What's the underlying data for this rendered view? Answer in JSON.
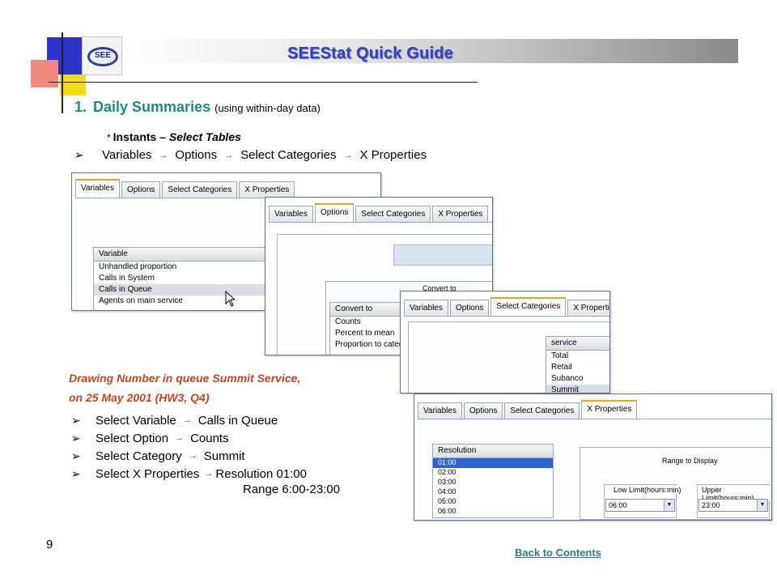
{
  "header": {
    "logo_text": "SEE",
    "title": "SEEStat Quick Guide"
  },
  "section": {
    "number": "1.",
    "title": "Daily Summaries",
    "subtitle": "(using within-day data)"
  },
  "instants": {
    "marker": "*",
    "label": "Instants – ",
    "emphasis": "Select Tables"
  },
  "flow": {
    "bullet": "➢",
    "arrow": "→",
    "items": [
      "Variables",
      "Options",
      "Select Categories",
      "X Properties"
    ]
  },
  "tabs": [
    "Variables",
    "Options",
    "Select Categories",
    "X Properties"
  ],
  "shot_variables": {
    "list_header": "Variable",
    "rows": [
      "Unhandled proportion",
      "Calls in System",
      "Calls in Queue",
      "Agents on main service"
    ],
    "selected_row": "Calls in Queue"
  },
  "shot_options": {
    "group_label": "Convert to",
    "list_header": "Convert to",
    "rows": [
      "Counts",
      "Percent to mean",
      "Proportion to category"
    ]
  },
  "shot_categories": {
    "list_header": "service",
    "rows": [
      "Total",
      "Retail",
      "Subanco",
      "Summit"
    ],
    "selected_row": "Summit"
  },
  "shot_xprops": {
    "list_header": "Resolution",
    "rows": [
      "01:00",
      "02:00",
      "03:00",
      "04:00",
      "05:00",
      "06:00"
    ],
    "selected_row": "01:00",
    "range_label": "Range to Display",
    "low_label": "Low Limit(hours:min)",
    "low_value": "06:00",
    "high_label": "Upper Limit(hours:min)",
    "high_value": "23:00",
    "dropdown_glyph": "▼"
  },
  "caption": {
    "line1": "Drawing Number in queue Summit Service,",
    "line2": "on 25 May 2001 (HW3, Q4)"
  },
  "steps": [
    {
      "prefix": "Select Variable",
      "value": "Calls in Queue"
    },
    {
      "prefix": "Select Option",
      "value": "Counts"
    },
    {
      "prefix": "Select Category",
      "value": "Summit"
    },
    {
      "prefix": "Select X Properties",
      "value": "Resolution 01:00"
    }
  ],
  "step_continuation": "Range 6:00-23:00",
  "footer": {
    "page_number": "9",
    "back_link": "Back to Contents"
  },
  "colors": {
    "title": "#2e3fd2",
    "heading": "#1a8c8c",
    "caption": "#c6451c",
    "link": "#2a7b8c"
  }
}
